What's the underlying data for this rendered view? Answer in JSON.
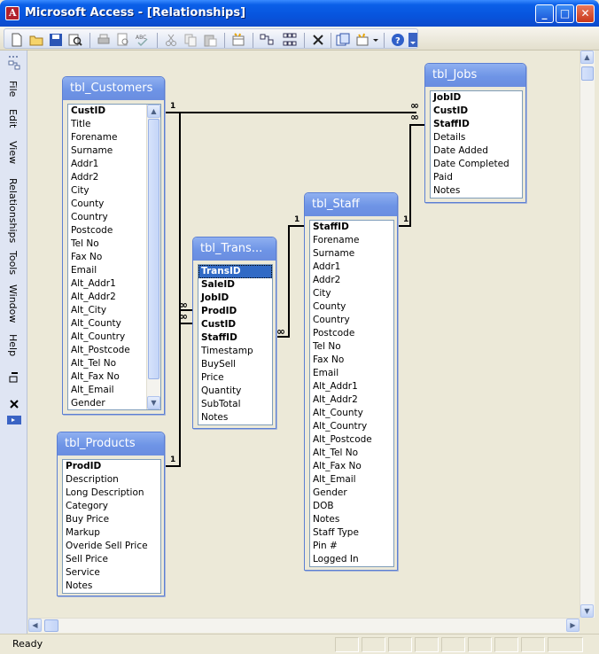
{
  "window": {
    "title": "Microsoft Access - [Relationships]"
  },
  "window_buttons": {
    "minimize": "_",
    "maximize": "□",
    "close": "✕"
  },
  "menu": [
    "File",
    "Edit",
    "View",
    "Relationships",
    "Tools",
    "Window",
    "Help"
  ],
  "toolbar": {
    "icons": [
      "new-icon",
      "open-icon",
      "save-icon",
      "search-icon",
      "print-icon",
      "print-preview-icon",
      "spelling-icon",
      "cut-icon",
      "copy-icon",
      "paste-icon",
      "show-table-icon",
      "show-direct-icon",
      "show-all-icon",
      "delete-icon",
      "relationship-report-icon",
      "new-object-icon",
      "help-icon"
    ]
  },
  "status": {
    "text": "Ready"
  },
  "tables": {
    "customers": {
      "name": "tbl_Customers",
      "fields": [
        "CustID",
        "Title",
        "Forename",
        "Surname",
        "Addr1",
        "Addr2",
        "City",
        "County",
        "Country",
        "Postcode",
        "Tel No",
        "Fax No",
        "Email",
        "Alt_Addr1",
        "Alt_Addr2",
        "Alt_City",
        "Alt_County",
        "Alt_Country",
        "Alt_Postcode",
        "Alt_Tel No",
        "Alt_Fax No",
        "Alt_Email",
        "Gender"
      ],
      "pk": [
        "CustID"
      ]
    },
    "jobs": {
      "name": "tbl_Jobs",
      "fields": [
        "JobID",
        "CustID",
        "StaffID",
        "Details",
        "Date Added",
        "Date Completed",
        "Paid",
        "Notes"
      ],
      "pk": [
        "JobID",
        "CustID",
        "StaffID"
      ]
    },
    "staff": {
      "name": "tbl_Staff",
      "fields": [
        "StaffID",
        "Forename",
        "Surname",
        "Addr1",
        "Addr2",
        "City",
        "County",
        "Country",
        "Postcode",
        "Tel No",
        "Fax No",
        "Email",
        "Alt_Addr1",
        "Alt_Addr2",
        "Alt_County",
        "Alt_Country",
        "Alt_Postcode",
        "Alt_Tel No",
        "Alt_Fax No",
        "Alt_Email",
        "Gender",
        "DOB",
        "Notes",
        "Staff Type",
        "Pin #",
        "Logged In"
      ],
      "pk": [
        "StaffID"
      ]
    },
    "trans": {
      "name": "tbl_Trans...",
      "fields": [
        "TransID",
        "SaleID",
        "JobID",
        "ProdID",
        "CustID",
        "StaffID",
        "Timestamp",
        "BuySell",
        "Price",
        "Quantity",
        "SubTotal",
        "Notes"
      ],
      "pk": [
        "TransID",
        "SaleID",
        "JobID",
        "ProdID",
        "CustID",
        "StaffID"
      ]
    },
    "products": {
      "name": "tbl_Products",
      "fields": [
        "ProdID",
        "Description",
        "Long Description",
        "Category",
        "Buy Price",
        "Markup",
        "Overide Sell Price",
        "Sell Price",
        "Service",
        "Notes"
      ],
      "pk": [
        "ProdID"
      ]
    }
  },
  "relationship_labels": {
    "one": "1",
    "many": "∞"
  }
}
